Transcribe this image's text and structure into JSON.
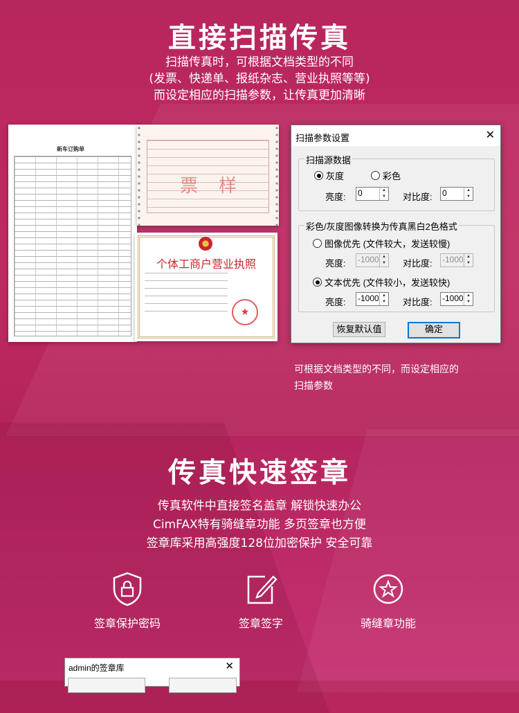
{
  "section1": {
    "title": "直接扫描传真",
    "subtitle_lines": [
      "扫描传真时，可根据文档类型的不同",
      "(发票、快递单、报纸杂志、营业执照等等)",
      "而设定相应的扫描参数，让传真更加清晰"
    ]
  },
  "documents": {
    "order_title": "新车订购单",
    "invoice_stamp_1": "票",
    "invoice_stamp_2": "样",
    "license_title": "个体工商户营业执照"
  },
  "dialog": {
    "title": "扫描参数设置",
    "source_group": "扫描源数据",
    "gray_option": "灰度",
    "color_option": "彩色",
    "brightness_label": "亮度:",
    "brightness_value": "0",
    "contrast_label": "对比度:",
    "contrast_value": "0",
    "convert_group": "彩色/灰度图像转换为传真黑白2色格式",
    "image_priority": "图像优先 (文件较大，发送较慢)",
    "image_brightness_label": "亮度:",
    "image_brightness_value": "-1000",
    "image_contrast_label": "对比度:",
    "image_contrast_value": "-1000",
    "text_priority": "文本优先 (文件较小，发送较快)",
    "text_brightness_label": "亮度:",
    "text_brightness_value": "-1000",
    "text_contrast_label": "对比度:",
    "text_contrast_value": "-1000",
    "reset_button": "恢复默认值",
    "ok_button": "确定"
  },
  "caption_lines": [
    "可根据文档类型的不同，而设定相应的",
    "扫描参数"
  ],
  "section2": {
    "title": "传真快速签章",
    "subtitle_lines": [
      "传真软件中直接签名盖章 解锁快速办公",
      "CimFAX特有骑缝章功能 多页签章也方便",
      "签章库采用高强度128位加密保护 安全可靠"
    ]
  },
  "features": [
    {
      "label": "签章保护密码",
      "icon": "shield-lock-icon"
    },
    {
      "label": "签章签字",
      "icon": "pen-edit-icon"
    },
    {
      "label": "骑缝章功能",
      "icon": "star-circle-icon"
    }
  ],
  "bottom_window": {
    "title": "admin的签章库"
  }
}
